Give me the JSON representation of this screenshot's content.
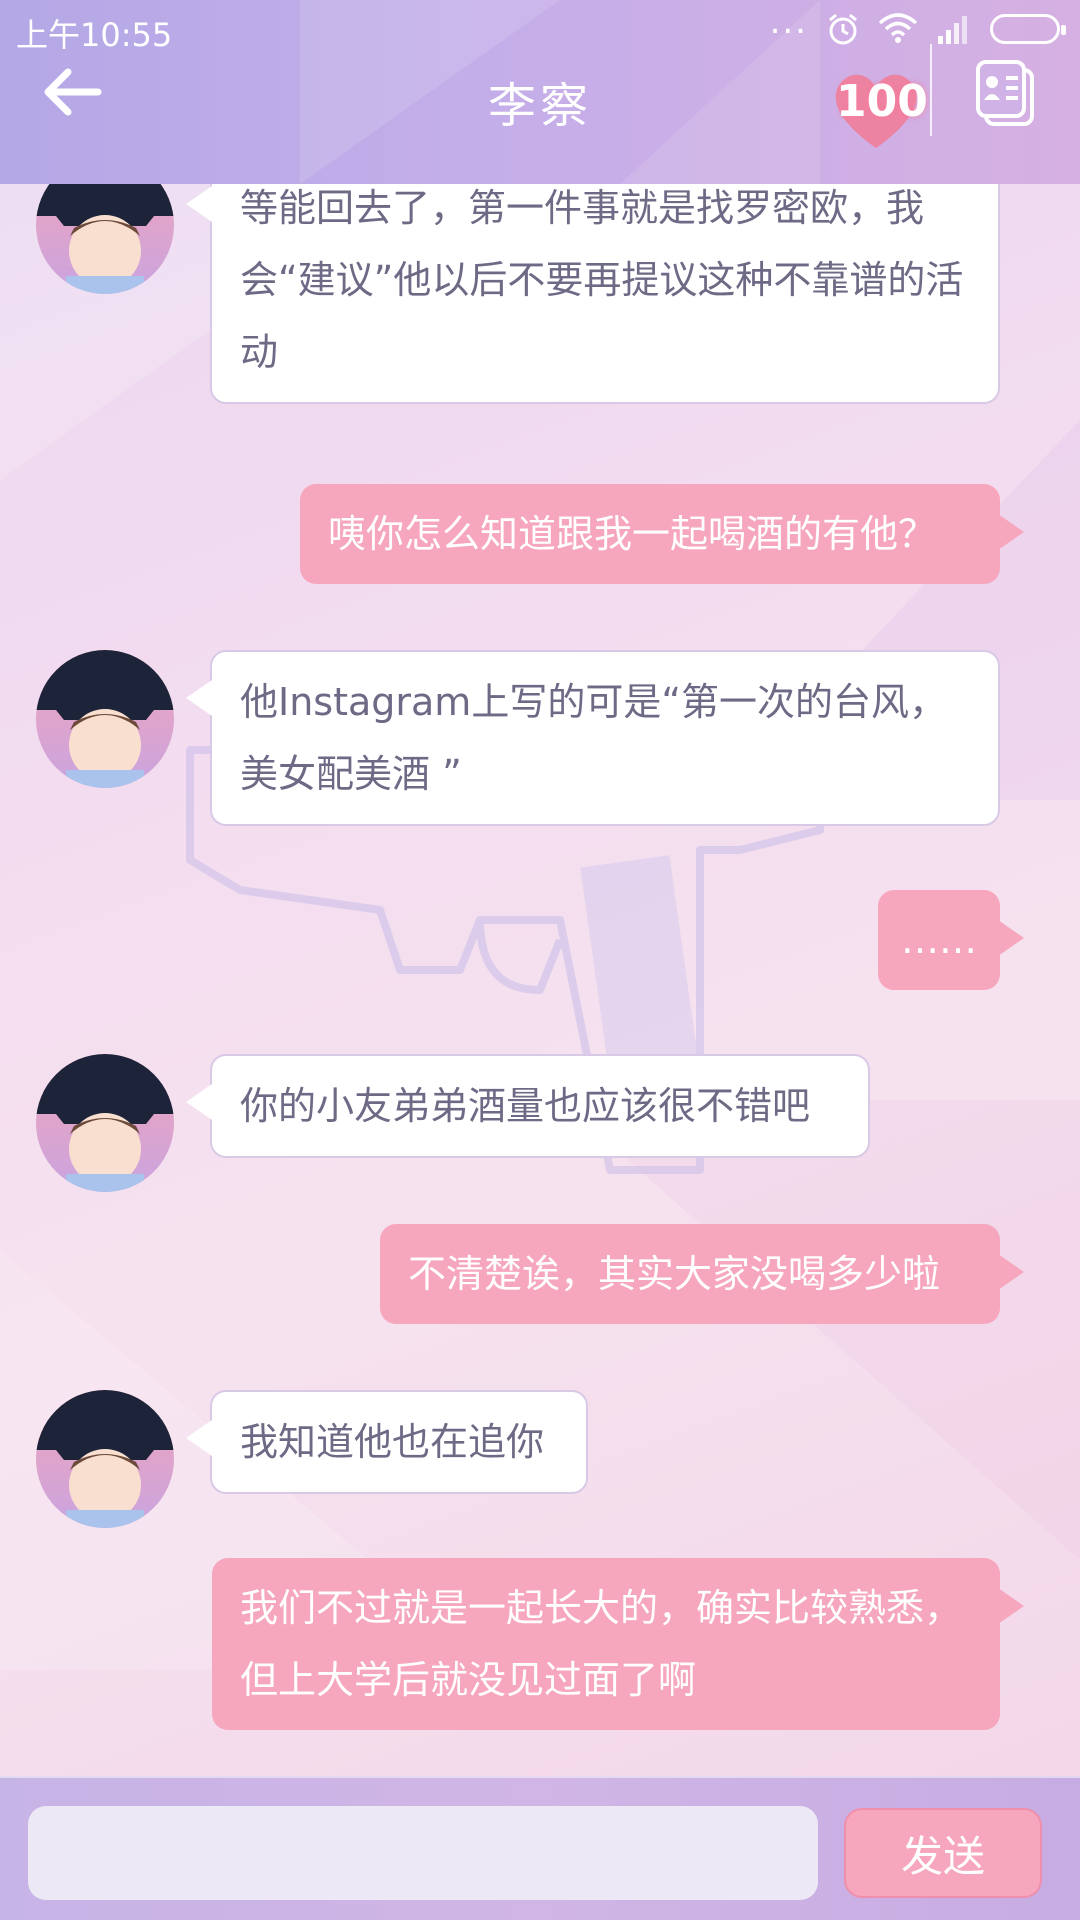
{
  "status_bar": {
    "time": "上午10:55",
    "dots": "..."
  },
  "header": {
    "title": "李察",
    "affection": "100"
  },
  "messages": [
    {
      "side": "in",
      "text": "等能回去了，第一件事就是找罗密欧，我会“建议”他以后不要再提议这种不靠谱的活动"
    },
    {
      "side": "out",
      "text": "咦你怎么知道跟我一起喝酒的有他？"
    },
    {
      "side": "in",
      "text": "他Instagram上写的可是“第一次的台风，美女配美酒 ”"
    },
    {
      "side": "out",
      "text": "……"
    },
    {
      "side": "in",
      "text": "你的小友弟弟酒量也应该很不错吧"
    },
    {
      "side": "out",
      "text": "不清楚诶，其实大家没喝多少啦"
    },
    {
      "side": "in",
      "text": "我知道他也在追你"
    },
    {
      "side": "out",
      "text": "我们不过就是一起长大的，确实比较熟悉，但上大学后就没见过面了啊"
    }
  ],
  "input": {
    "placeholder": "",
    "send_label": "发送"
  },
  "colors": {
    "outgoing_bubble": "#f6a6bd",
    "incoming_bubble": "#ffffff",
    "header": "#c4aee9"
  }
}
